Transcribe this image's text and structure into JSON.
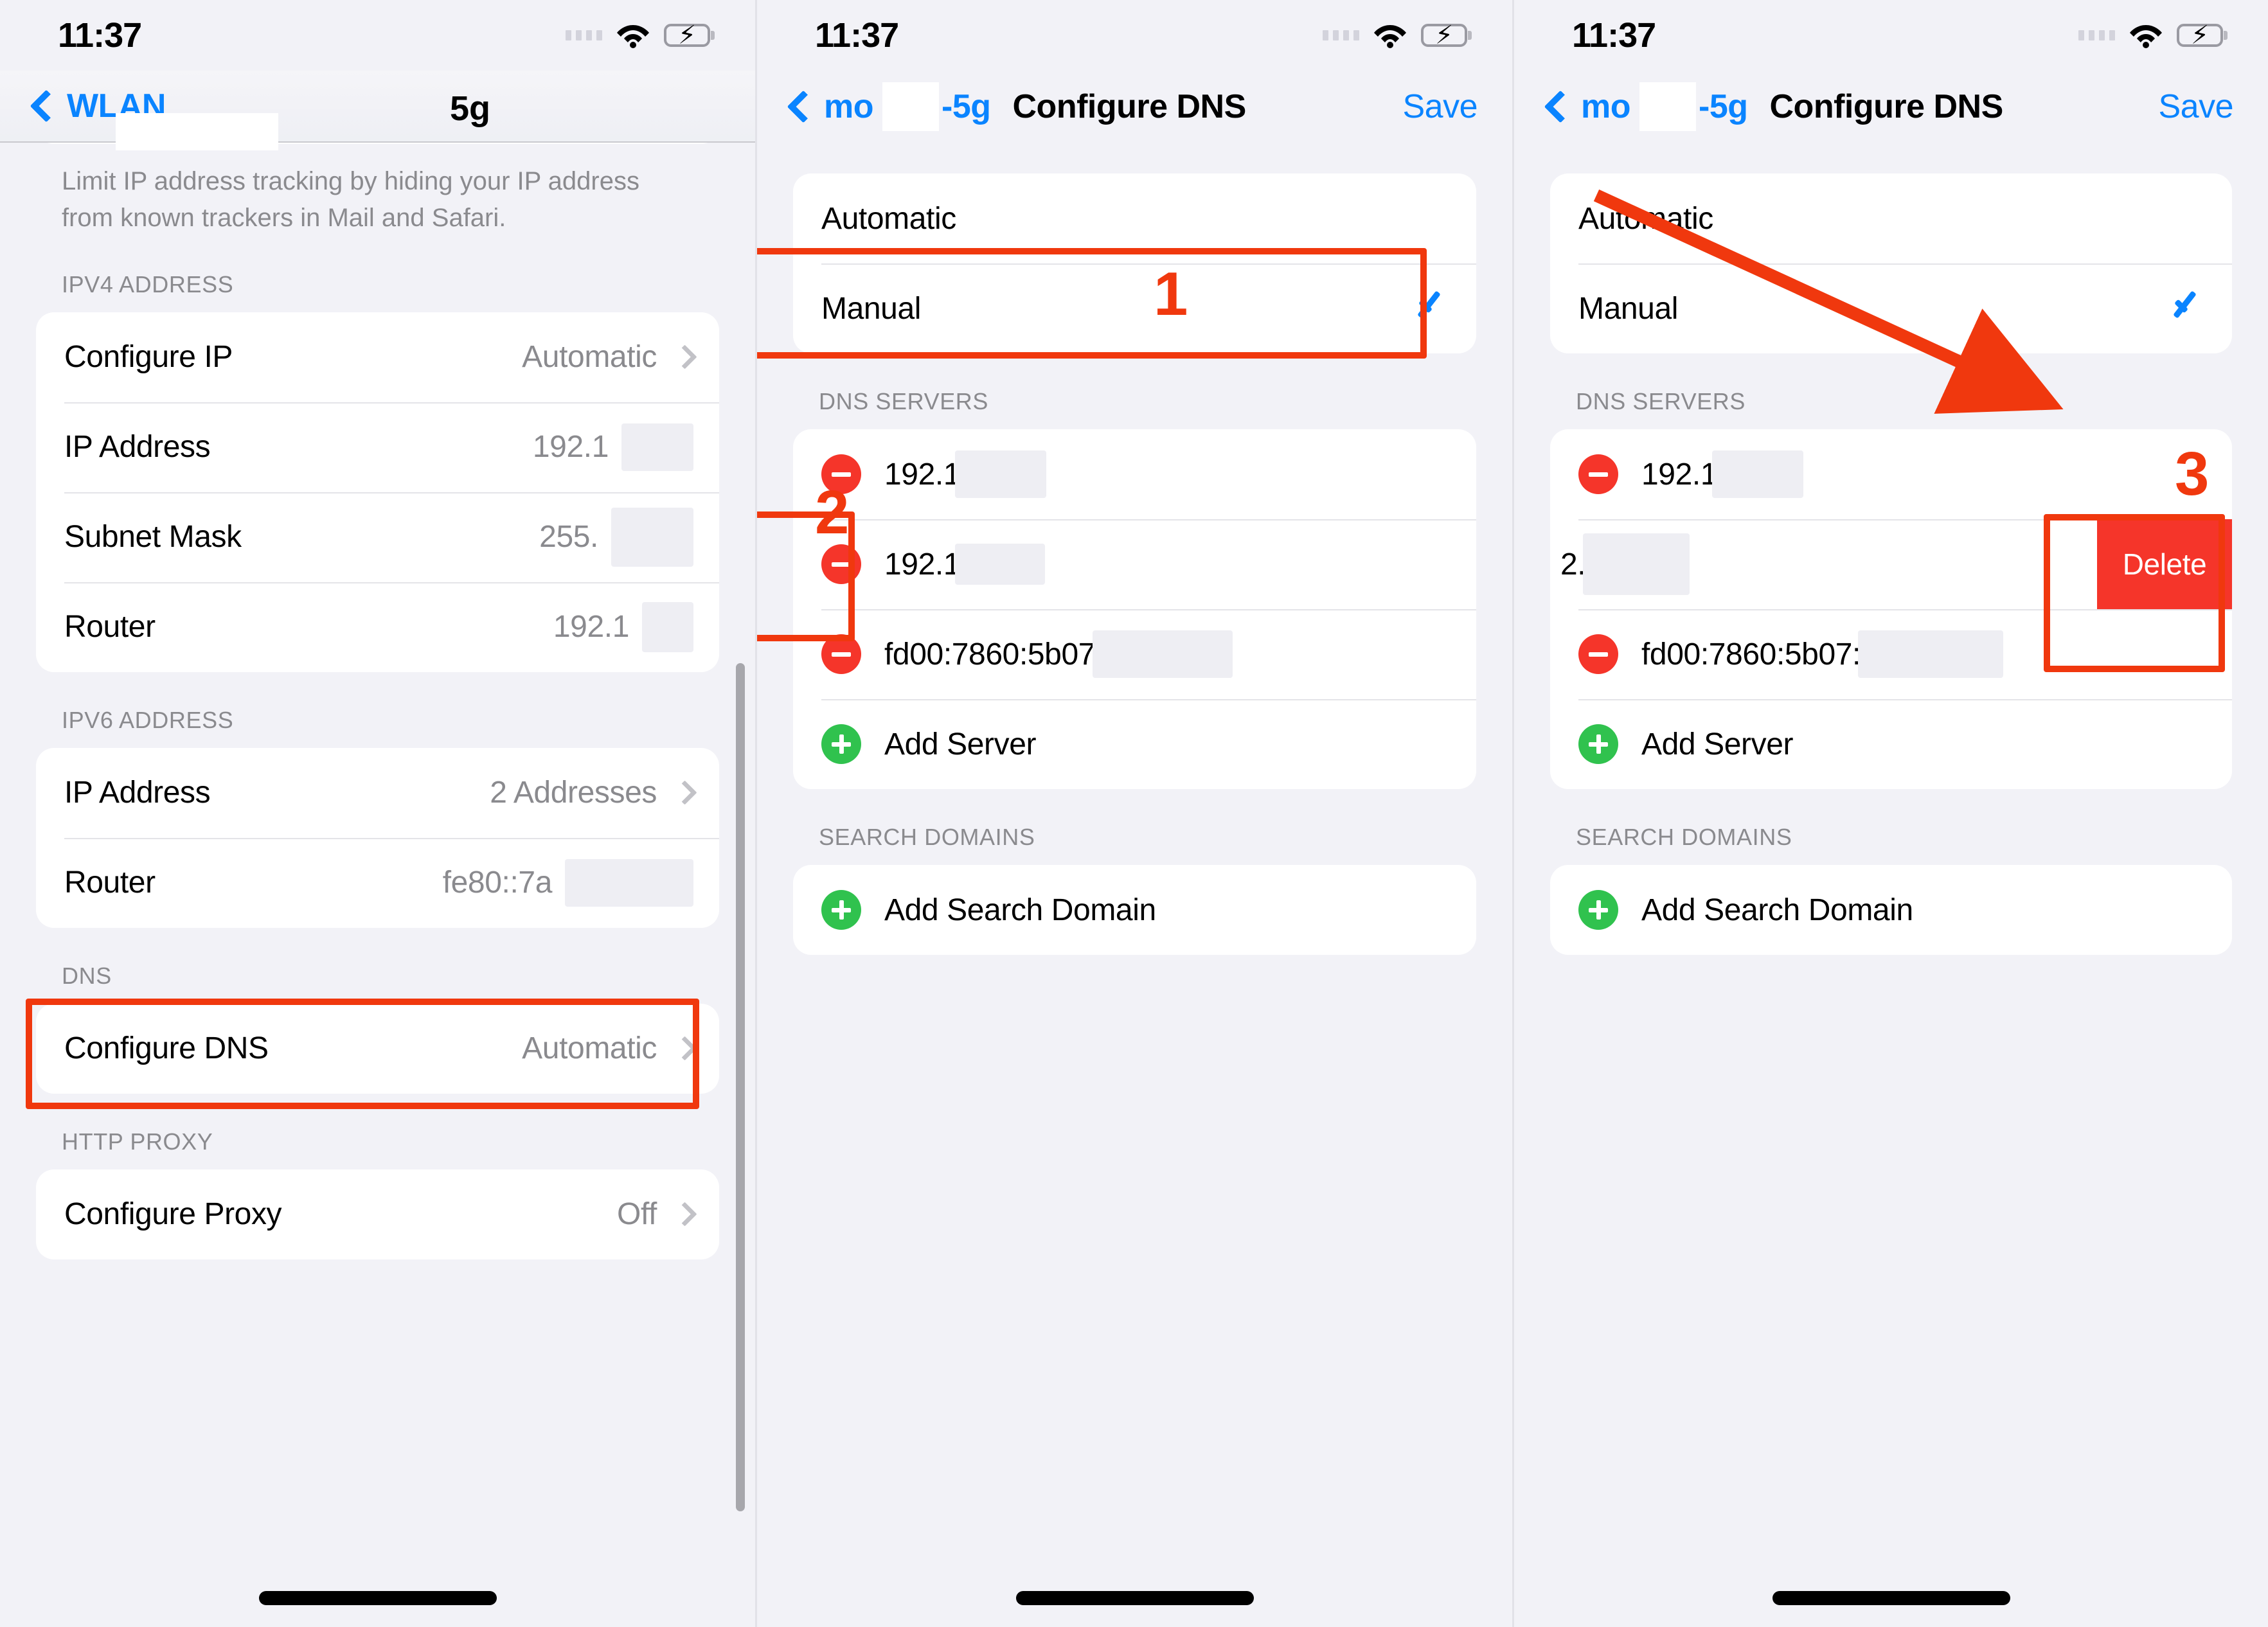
{
  "statusbar": {
    "time": "11:37"
  },
  "panel1": {
    "nav": {
      "back_label": "WLAN",
      "title_suffix": "5g"
    },
    "footnote": "Limit IP address tracking by hiding your IP address from known trackers in Mail and Safari.",
    "sections": [
      {
        "header": "IPV4 ADDRESS",
        "rows": [
          {
            "label": "Configure IP",
            "value": "Automatic",
            "chevron": true
          },
          {
            "label": "IP Address",
            "value": "192.1",
            "redacted": true
          },
          {
            "label": "Subnet Mask",
            "value": "255.",
            "redacted": true
          },
          {
            "label": "Router",
            "value": "192.1",
            "redacted": true
          }
        ]
      },
      {
        "header": "IPV6 ADDRESS",
        "rows": [
          {
            "label": "IP Address",
            "value": "2 Addresses",
            "chevron": true
          },
          {
            "label": "Router",
            "value": "fe80::7a",
            "redacted": true
          }
        ]
      },
      {
        "header": "DNS",
        "rows": [
          {
            "label": "Configure DNS",
            "value": "Automatic",
            "chevron": true
          }
        ]
      },
      {
        "header": "HTTP PROXY",
        "rows": [
          {
            "label": "Configure Proxy",
            "value": "Off",
            "chevron": true
          }
        ]
      }
    ]
  },
  "panel2": {
    "nav": {
      "back_prefix": "mo",
      "back_suffix": "-5g",
      "title": "Configure DNS",
      "save": "Save"
    },
    "mode_options": [
      {
        "label": "Automatic",
        "selected": false
      },
      {
        "label": "Manual",
        "selected": true
      }
    ],
    "dns_section_header": "DNS SERVERS",
    "dns_servers": [
      {
        "value": "192.1",
        "redacted": true
      },
      {
        "value": "192.1",
        "redacted": true
      },
      {
        "value": "fd00:7860:5b07",
        "redacted": true
      }
    ],
    "add_server_label": "Add Server",
    "search_section_header": "SEARCH DOMAINS",
    "add_search_domain_label": "Add Search Domain",
    "annotations": {
      "step1": "1",
      "step2": "2"
    }
  },
  "panel3": {
    "nav": {
      "back_prefix": "mo",
      "back_suffix": "-5g",
      "title": "Configure DNS",
      "save": "Save"
    },
    "mode_options": [
      {
        "label": "Automatic",
        "selected": false
      },
      {
        "label": "Manual",
        "selected": true
      }
    ],
    "dns_section_header": "DNS SERVERS",
    "dns_servers": [
      {
        "value": "192.1",
        "redacted": true,
        "swiped": false
      },
      {
        "value": "2.",
        "redacted": true,
        "swiped": true
      },
      {
        "value": "fd00:7860:5b07:",
        "redacted": true,
        "swiped": false
      }
    ],
    "delete_label": "Delete",
    "add_server_label": "Add Server",
    "search_section_header": "SEARCH DOMAINS",
    "add_search_domain_label": "Add Search Domain",
    "annotations": {
      "step3": "3"
    }
  },
  "colors": {
    "accent_blue": "#0a84ff",
    "annotation_red": "#f0380e",
    "destructive_red": "#f5352a",
    "add_green": "#30c24e",
    "page_bg": "#f2f2f7"
  }
}
